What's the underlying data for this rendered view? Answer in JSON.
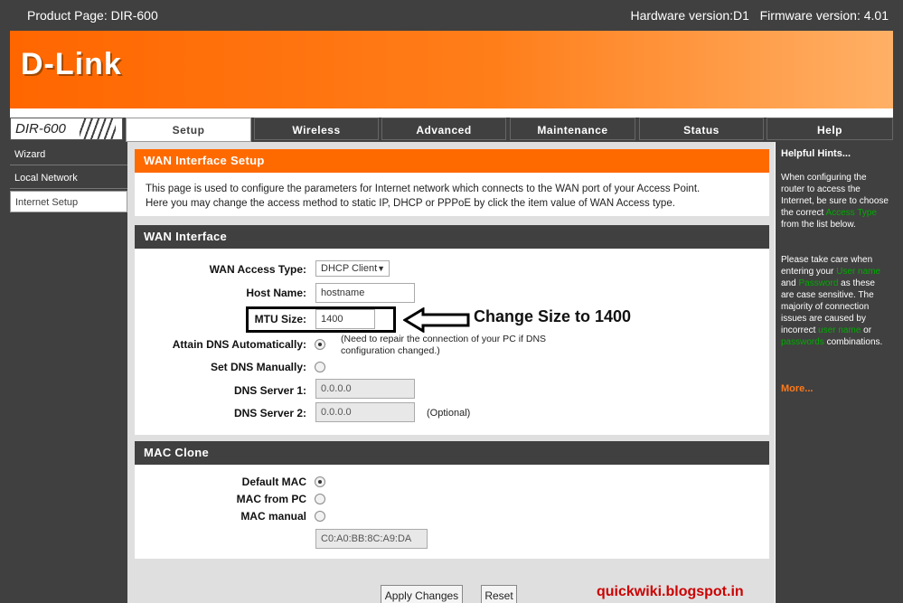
{
  "topbar": {
    "product": "Product Page: DIR-600",
    "versions": "Hardware version:D1   Firmware version: 4.01"
  },
  "brand": {
    "logo": "D-Link",
    "model": "DIR-600"
  },
  "tabs": [
    {
      "label": "Setup"
    },
    {
      "label": "Wireless"
    },
    {
      "label": "Advanced"
    },
    {
      "label": "Maintenance"
    },
    {
      "label": "Status"
    },
    {
      "label": "Help"
    }
  ],
  "sidebar": {
    "items": [
      {
        "label": "Wizard"
      },
      {
        "label": "Local Network"
      },
      {
        "label": "Internet Setup"
      }
    ]
  },
  "wan_setup": {
    "title": "WAN Interface Setup",
    "desc1": "This page is used to configure the parameters for Internet network which connects to the WAN port of your Access Point.",
    "desc2": "Here you may change the access method to static IP, DHCP or PPPoE by click the item value of WAN Access type."
  },
  "wan": {
    "title": "WAN Interface",
    "access_type_label": "WAN Access Type:",
    "access_type_value": "DHCP Client",
    "host_label": "Host Name:",
    "host_value": "hostname",
    "mtu_label": "MTU Size:",
    "mtu_value": "1400",
    "attain_dns_label": "Attain DNS Automatically:",
    "attain_dns_note1": "(Need to repair the connection of your PC if DNS",
    "attain_dns_note2": "configuration changed.)",
    "set_dns_label": "Set DNS Manually:",
    "dns1_label": "DNS Server 1:",
    "dns1_value": "0.0.0.0",
    "dns2_label": "DNS Server 2:",
    "dns2_value": "0.0.0.0",
    "dns2_note": "(Optional)"
  },
  "mac": {
    "title": "MAC Clone",
    "default_label": "Default MAC",
    "from_pc_label": "MAC from PC",
    "manual_label": "MAC manual",
    "manual_value": "C0:A0:BB:8C:A9:DA"
  },
  "buttons": {
    "apply": "Apply Changes",
    "reset": "Reset"
  },
  "hints": {
    "title": "Helpful Hints...",
    "p1_a": "When configuring the router to access the Internet, be sure to choose the correct",
    "p1_link": "Access Type",
    "p1_b": "from the list below.",
    "p2_a": "Please take care when entering your",
    "p2_link1": "User name",
    "p2_b": "and",
    "p2_link2": "Password",
    "p2_c": "as these are case sensitive. The majority of connection issues are caused by incorrect",
    "p2_link3": "user name",
    "p2_d": "or",
    "p2_link4": "passwords",
    "p2_e": "combinations.",
    "more": "More..."
  },
  "annotation": {
    "text": "Change Size to 1400"
  },
  "watermark": "quickwiki.blogspot.in",
  "colors": {
    "accent": "#ff6600",
    "dark": "#404040",
    "green_hint": "#00aa00"
  }
}
